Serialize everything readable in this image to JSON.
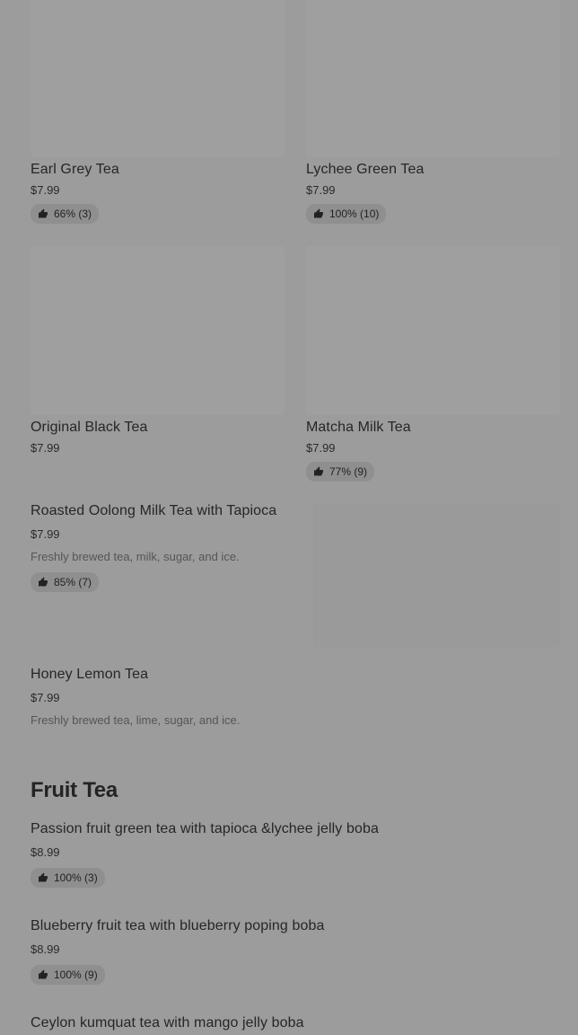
{
  "grid_items": [
    {
      "name": "Earl Grey Tea",
      "price": "$7.99",
      "rating": "66% (3)"
    },
    {
      "name": "Lychee Green Tea",
      "price": "$7.99",
      "rating": "100% (10)"
    },
    {
      "name": "Original Black Tea",
      "price": "$7.99",
      "rating": ""
    },
    {
      "name": "Matcha Milk Tea",
      "price": "$7.99",
      "rating": "77% (9)"
    }
  ],
  "list_items": [
    {
      "name": "Roasted Oolong Milk Tea with Tapioca",
      "price": "$7.99",
      "description": "Freshly brewed tea, milk, sugar, and ice.",
      "rating": "85% (7)"
    },
    {
      "name": "Honey Lemon Tea",
      "price": "$7.99",
      "description": "Freshly brewed tea, lime, sugar, and ice."
    }
  ],
  "fruit_tea": {
    "title": "Fruit Tea",
    "items": [
      {
        "name": "Passion fruit green tea with tapioca &lychee jelly boba",
        "price": "$8.99",
        "rating": "100% (3)"
      },
      {
        "name": "Blueberry fruit tea with blueberry poping boba",
        "price": "$8.99",
        "rating": "100% (9)"
      },
      {
        "name": "Ceylon kumquat tea with mango jelly boba"
      }
    ]
  },
  "icons": {
    "rating": "thumbs-up-icon"
  },
  "colors": {
    "overlay_background": "#9c9c9c",
    "badge_background": "#8f8f8f",
    "image_placeholder": "#9f9f9f"
  }
}
